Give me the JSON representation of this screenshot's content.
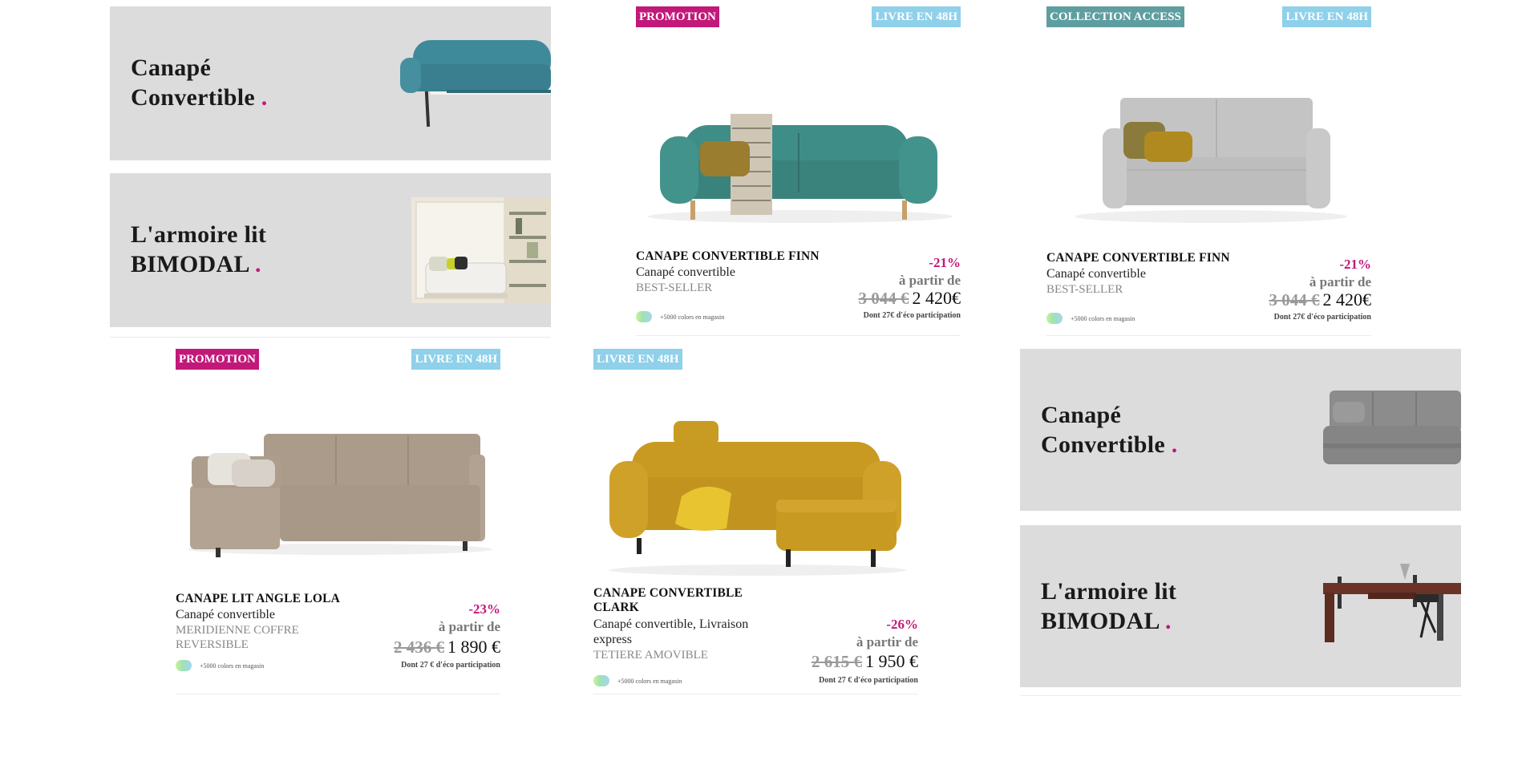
{
  "banners": [
    {
      "line1": "Canapé",
      "line2": "Convertible",
      "dot": "."
    },
    {
      "line1": "L'armoire lit",
      "line2": "BIMODAL",
      "dot": "."
    },
    {
      "line1": "Canapé",
      "line2": "Convertible",
      "dot": "."
    },
    {
      "line1": "L'armoire lit",
      "line2": "BIMODAL",
      "dot": "."
    }
  ],
  "products": [
    {
      "badge_left": "PROMOTION",
      "badge_right": "LIVRE EN 48H",
      "name": "CANAPE CONVERTIBLE FINN",
      "type": "Canapé convertible",
      "sub": "BEST-SELLER",
      "discount": "-21%",
      "from": "à partir de",
      "old_price": "3 044 €",
      "new_price": "2 420€",
      "eco": "Dont 27€ d'éco participation",
      "colors": "+5000 colors en magasin",
      "image": "teal-sofa-with-throw"
    },
    {
      "badge_left": "COLLECTION ACCESS",
      "badge_right": "LIVRE EN 48H",
      "name": "CANAPE CONVERTIBLE FINN",
      "type": "Canapé convertible",
      "sub": "BEST-SELLER",
      "discount": "-21%",
      "from": "à partir de",
      "old_price": "3 044 €",
      "new_price": "2 420€",
      "eco": "Dont 27€ d'éco participation",
      "colors": "+5000 colors en magasin",
      "image": "grey-sofa"
    },
    {
      "badge_left": "PROMOTION",
      "badge_right": "LIVRE EN 48H",
      "name": "CANAPE LIT ANGLE LOLA",
      "type": "Canapé convertible",
      "sub": "MERIDIENNE COFFRE REVERSIBLE",
      "discount": "-23%",
      "from": "à partir de",
      "old_price": "2 436 €",
      "new_price": "1 890 €",
      "eco": "Dont 27 € d'éco participation",
      "colors": "+5000 colors en magasin",
      "image": "beige-corner-sofa"
    },
    {
      "badge_left": "LIVRE EN 48H",
      "name": "CANAPE CONVERTIBLE CLARK",
      "type": "Canapé convertible, Livraison express",
      "sub": "TETIERE AMOVIBLE",
      "discount": "-26%",
      "from": "à partir de",
      "old_price": "2 615 €",
      "new_price": "1 950 €",
      "eco": "Dont 27 € d'éco participation",
      "colors": "+5000 colors en magasin",
      "image": "mustard-sofa-with-ottoman"
    }
  ],
  "colors": {
    "accent": "#c2187a",
    "ship_badge": "#8fd0ea",
    "collection_badge": "#5f9ea0",
    "banner_bg": "#dcdcdc"
  }
}
